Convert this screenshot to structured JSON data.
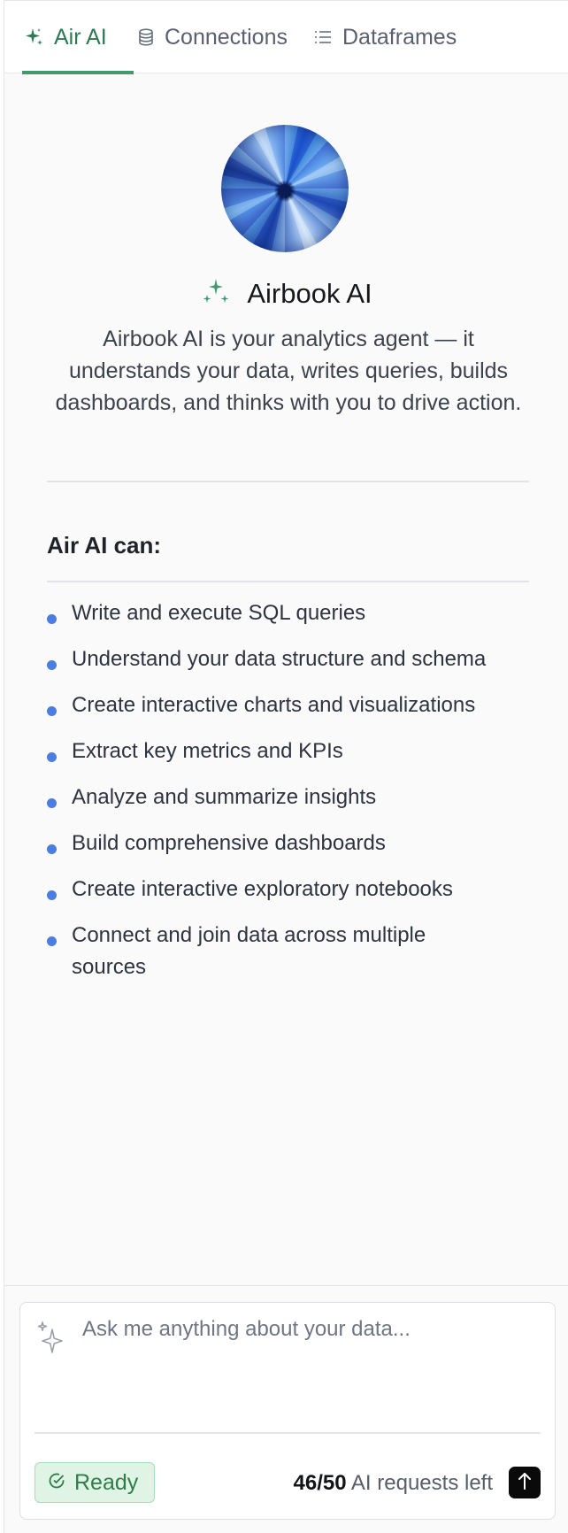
{
  "tabs": [
    {
      "label": "Air AI",
      "icon": "sparkle-icon",
      "active": true
    },
    {
      "label": "Connections",
      "icon": "database-icon",
      "active": false
    },
    {
      "label": "Dataframes",
      "icon": "list-icon",
      "active": false
    }
  ],
  "hero": {
    "title": "Airbook AI",
    "description": "Airbook AI is your analytics agent — it understands your data, writes queries, builds dashboards, and thinks with you to drive action."
  },
  "capabilities": {
    "heading": "Air AI can:",
    "items": [
      "Write and execute SQL queries",
      "Understand your data structure and schema",
      "Create interactive charts and visualizations",
      "Extract key metrics and KPIs",
      "Analyze and summarize insights",
      "Build comprehensive dashboards",
      "Create interactive exploratory notebooks",
      "Connect and join data across multiple sources"
    ]
  },
  "chat": {
    "placeholder": "Ask me anything about your data...",
    "status_label": "Ready",
    "requests_used": "46/50",
    "requests_suffix": "AI requests left"
  },
  "colors": {
    "accent_green": "#3f9a6c",
    "bullet_blue": "#4a7de0",
    "ready_bg": "#dff4e4"
  }
}
